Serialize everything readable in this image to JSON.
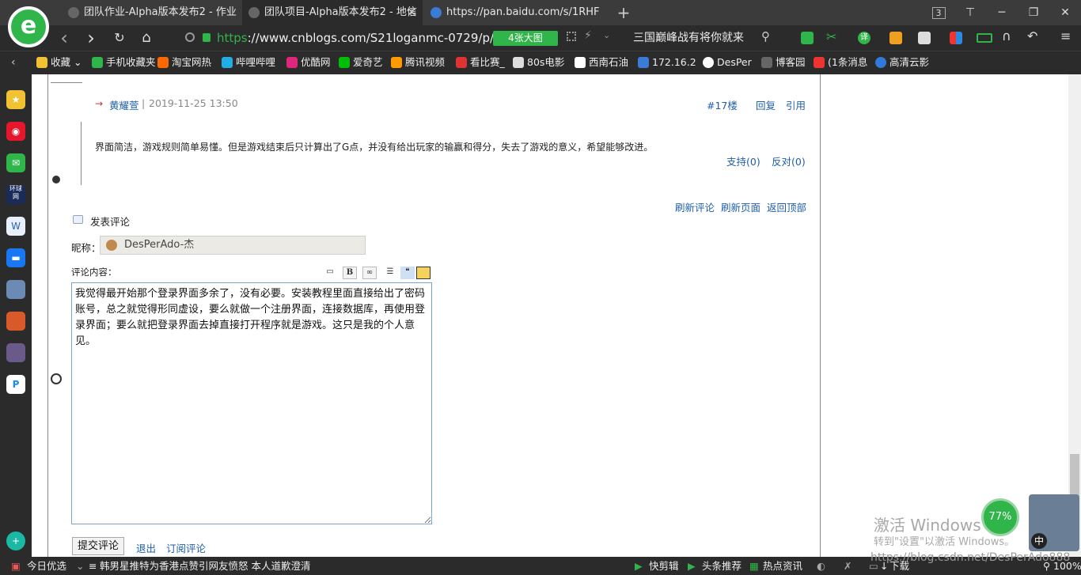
{
  "browser": {
    "tabs": [
      {
        "label": "团队作业-Alpha版本发布2 - 作业"
      },
      {
        "label": "团队项目-Alpha版本发布2 - 地信"
      },
      {
        "label": "https://pan.baidu.com/s/1RHF"
      }
    ],
    "tab_close": "✕",
    "new_tab": "+",
    "tab_count": "3",
    "window_controls": {
      "restore": "❐",
      "minimize": "─",
      "maximize": "☐",
      "close": "✕"
    },
    "nav": {
      "back": "‹",
      "forward": "›",
      "reload": "↻",
      "home": "⌂"
    },
    "address": {
      "scheme": "https",
      "rest": "://www.cnblogs.com/S21loganmc-0729/p/11"
    },
    "image_badge": "4张大图",
    "news_link": "三国巅峰战有将你就来",
    "bookmarks": [
      {
        "label": "收藏",
        "color": "#f1c232"
      },
      {
        "label": "手机收藏夹",
        "color": "#2fb54a"
      },
      {
        "label": "淘宝网热",
        "color": "#ff6a00"
      },
      {
        "label": "哔哩哔哩",
        "color": "#23ade5"
      },
      {
        "label": "优酷网",
        "color": "#e0267a"
      },
      {
        "label": "爱奇艺",
        "color": "#00be06"
      },
      {
        "label": "腾讯视频",
        "color": "#ff9a00"
      },
      {
        "label": "看比赛_",
        "color": "#d33"
      },
      {
        "label": "80s电影",
        "color": "#ddd"
      },
      {
        "label": "西南石油",
        "color": "#fff"
      },
      {
        "label": "172.16.2",
        "color": "#3a7bd5"
      },
      {
        "label": "DesPer",
        "color": "#fff"
      },
      {
        "label": "博客园",
        "color": "#666"
      },
      {
        "label": "(1条消息",
        "color": "#e33"
      },
      {
        "label": "高清云影",
        "color": "#2f7bd9"
      }
    ]
  },
  "comment": {
    "arrow": "→",
    "author": "黄耀萱",
    "sep": "|",
    "time": "2019-11-25 13:50",
    "floor": "#17楼",
    "reply": "回复",
    "quote": "引用",
    "body": "界面简洁，游戏规则简单易懂。但是游戏结束后只计算出了G点，并没有给出玩家的输赢和得分，失去了游戏的意义，希望能够改进。",
    "support": "支持(0)",
    "oppose": "反对(0)"
  },
  "links": {
    "refresh_comments": "刷新评论",
    "refresh_page": "刷新页面",
    "back_top": "返回顶部"
  },
  "form": {
    "title": "发表评论",
    "nick_label": "昵称：",
    "nick_value": "DesPerAdo-杰",
    "content_label": "评论内容：",
    "tools": {
      "bold": "B"
    },
    "content_value": "我觉得最开始那个登录界面多余了，没有必要。安装教程里面直接给出了密码账号，总之就觉得形同虚设，要么就做一个注册界面，连接数据库，再使用登录界面；要么就把登录界面去掉直接打开程序就是游戏。这只是我的个人意见。",
    "submit": "提交评论",
    "logout": "退出",
    "subscribe": "订阅评论"
  },
  "overlay": {
    "watermark_title": "激活 Windows",
    "watermark_sub": "转到\"设置\"以激活 Windows。",
    "gauge": "77%",
    "ime": "中",
    "csdn": "https://blog.csdn.net/DesPerAdo888"
  },
  "status": {
    "today": "今日优选",
    "news": "韩男星推特为香港点赞引网友愤怒 本人道歉澄清",
    "clip": "快剪辑",
    "headline": "头条推荐",
    "hotnews": "热点资讯",
    "download": "下载",
    "zoom": "100%"
  }
}
